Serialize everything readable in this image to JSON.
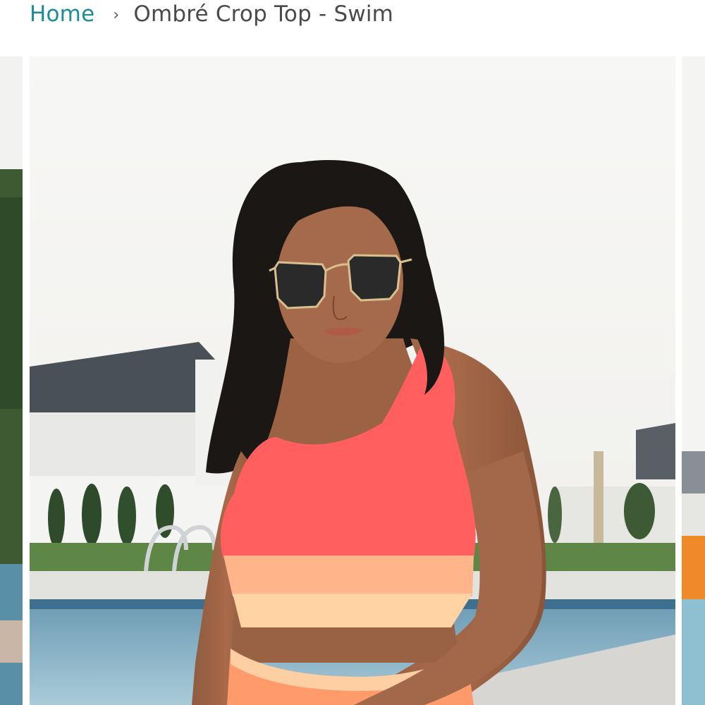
{
  "breadcrumb": {
    "home_label": "Home",
    "separator": "›",
    "current_label": "Ombré Crop Top - Swim"
  },
  "gallery": {
    "main_image_name": "model-wearing-ombre-crop-top-swim",
    "prev_image_name": "previous-product-photo",
    "next_image_name": "next-product-photo"
  },
  "colors": {
    "link": "#1c8c96",
    "text": "#4a4a4a",
    "top_coral": "#ff5f5f",
    "top_peach": "#ffb48a",
    "top_cream": "#ffd3a2"
  }
}
